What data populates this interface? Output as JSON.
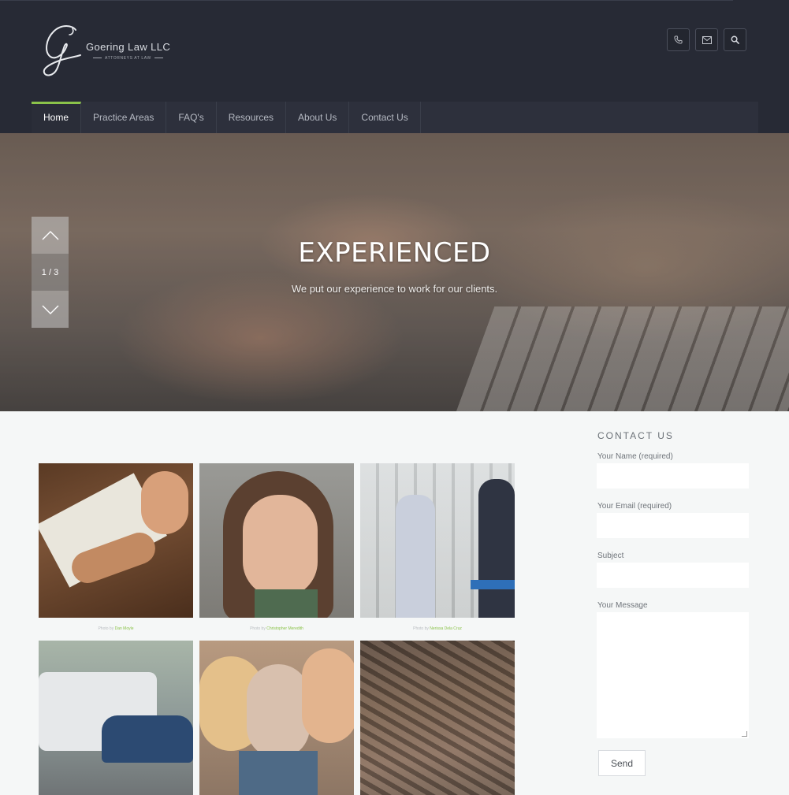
{
  "brand": {
    "name": "Goering Law LLC",
    "tagline": "ATTORNEYS AT LAW"
  },
  "header_buttons": [
    "phone-icon",
    "mail-icon",
    "search-icon"
  ],
  "nav": {
    "items": [
      {
        "label": "Home",
        "active": true
      },
      {
        "label": "Practice Areas",
        "active": false
      },
      {
        "label": "FAQ's",
        "active": false
      },
      {
        "label": "Resources",
        "active": false
      },
      {
        "label": "About Us",
        "active": false
      },
      {
        "label": "Contact Us",
        "active": false
      }
    ]
  },
  "hero": {
    "title": "EXPERIENCED",
    "subtitle": "We put our experience to work for our clients.",
    "counter": "1 / 3"
  },
  "gallery": {
    "captions": [
      {
        "prefix": "Photo by",
        "author": "Dan Moyle"
      },
      {
        "prefix": "Photo by",
        "author": "Christopher Meredith"
      },
      {
        "prefix": "Photo by",
        "author": "Nerissa Dela Cruz"
      }
    ]
  },
  "contact": {
    "title": "CONTACT US",
    "name_label": "Your Name (required)",
    "email_label": "Your Email (required)",
    "subject_label": "Subject",
    "message_label": "Your Message",
    "send_label": "Send"
  },
  "colors": {
    "header_bg": "#272a35",
    "nav_bg": "#2d303c",
    "accent": "#8bc34a",
    "page_bg": "#f5f7f7"
  }
}
